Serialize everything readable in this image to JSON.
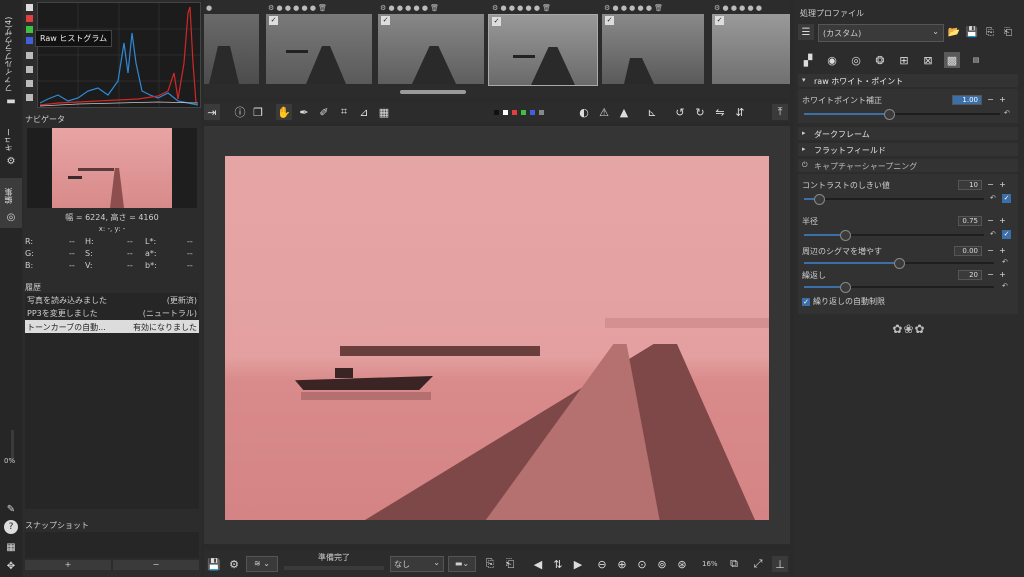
{
  "left_tabs": {
    "file_browser": "ファイルブラウザ(4)",
    "queue": "キュー",
    "editor": "編集",
    "zoom_pct": "0%"
  },
  "histogram": {
    "tooltip": "Raw ヒストグラム"
  },
  "navigator": {
    "title": "ナビゲータ",
    "dims": "幅 = 6224, 高さ = 4160",
    "coords": "x: -, y: -",
    "readouts": [
      {
        "l": "R:",
        "v": "--",
        "l2": "H:",
        "v2": "--",
        "l3": "L*:",
        "v3": "--"
      },
      {
        "l": "G:",
        "v": "--",
        "l2": "S:",
        "v2": "--",
        "l3": "a*:",
        "v3": "--"
      },
      {
        "l": "B:",
        "v": "--",
        "l2": "V:",
        "v2": "--",
        "l3": "b*:",
        "v3": "--"
      }
    ]
  },
  "history": {
    "title": "履歴",
    "items": [
      {
        "action": "写真を読み込みました",
        "value": "(更新済)"
      },
      {
        "action": "PP3を変更しました",
        "value": "(ニュートラル)"
      },
      {
        "action": "トーンカーブの自動...",
        "value": "有効になりました"
      }
    ]
  },
  "snapshot": {
    "title": "スナップショット",
    "add": "+",
    "remove": "−"
  },
  "bottom": {
    "status": "準備完了",
    "dropdown": "なし",
    "zoom": "16%"
  },
  "right": {
    "profile_title": "処理プロファイル",
    "profile_value": "(カスタム)",
    "raw_wb": {
      "title": "raw ホワイト・ポイント",
      "label": "ホワイトポイント補正",
      "value": "1.00",
      "fill": 0.5
    },
    "dark_frame": "ダークフレーム",
    "flat_field": "フラットフィールド",
    "capture": {
      "title": "キャプチャーシャープニング",
      "params": [
        {
          "label": "コントラストのしきい値",
          "value": "10",
          "fill": 0.08
        },
        {
          "label": "半径",
          "value": "0.75",
          "fill": 0.22
        },
        {
          "label": "周辺のシグマを増やす",
          "value": "0.00",
          "fill": 0.5
        },
        {
          "label": "繰返し",
          "value": "20",
          "fill": 0.2
        }
      ],
      "auto_limit": "繰り返しの自動制限"
    }
  },
  "colors": {
    "bg": "#2a2a2a",
    "panel": "#2f2f2f",
    "accent": "#3c6ea8",
    "photo_sky": "#e6a0a0",
    "photo_water": "#d58787"
  }
}
